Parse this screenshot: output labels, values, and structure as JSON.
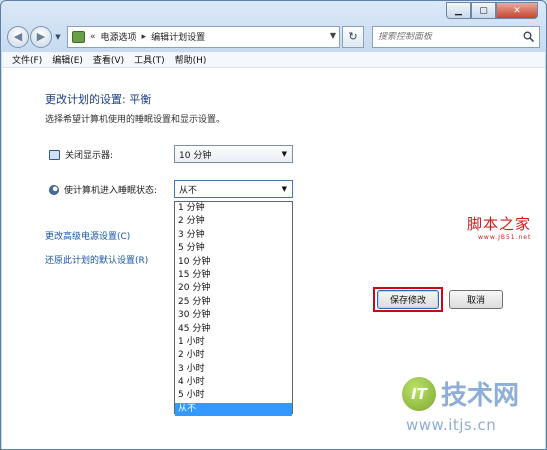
{
  "window": {
    "minimize_icon": "minimize-icon",
    "maximize_icon": "maximize-icon",
    "close_icon": "close-icon"
  },
  "navbar": {
    "back_icon": "back-arrow-icon",
    "forward_icon": "forward-arrow-icon",
    "breadcrumb_prefix": "«",
    "breadcrumb": [
      "电源选项",
      "编辑计划设置"
    ],
    "search_placeholder": "搜索控制面板"
  },
  "menu": [
    {
      "label": "文件(F)"
    },
    {
      "label": "编辑(E)"
    },
    {
      "label": "查看(V)"
    },
    {
      "label": "工具(T)"
    },
    {
      "label": "帮助(H)"
    }
  ],
  "page": {
    "heading": "更改计划的设置: 平衡",
    "description": "选择希望计算机使用的睡眠设置和显示设置。",
    "display_off_label": "关闭显示器:",
    "display_off_value": "10 分钟",
    "sleep_label": "使计算机进入睡眠状态:",
    "sleep_value": "从不",
    "advanced_link": "更改高级电源设置(C)",
    "restore_link": "还原此计划的默认设置(R)",
    "save_button": "保存修改",
    "cancel_button": "取消"
  },
  "sleep_options": [
    "1 分钟",
    "2 分钟",
    "3 分钟",
    "5 分钟",
    "10 分钟",
    "15 分钟",
    "20 分钟",
    "25 分钟",
    "30 分钟",
    "45 分钟",
    "1 小时",
    "2 小时",
    "3 小时",
    "4 小时",
    "5 小时",
    "从不"
  ],
  "selected_sleep_option_index": 15,
  "watermarks": {
    "jb51_name": "脚本之家",
    "jb51_url": "www.JB51.net",
    "itjs_logo": "IT",
    "itjs_name": "技术网",
    "itjs_url": "www.itjs.cn"
  },
  "colors": {
    "heading": "#1d3f85",
    "link": "#1a56a8",
    "selection": "#3399ff",
    "highlight_box": "#d4001a"
  }
}
